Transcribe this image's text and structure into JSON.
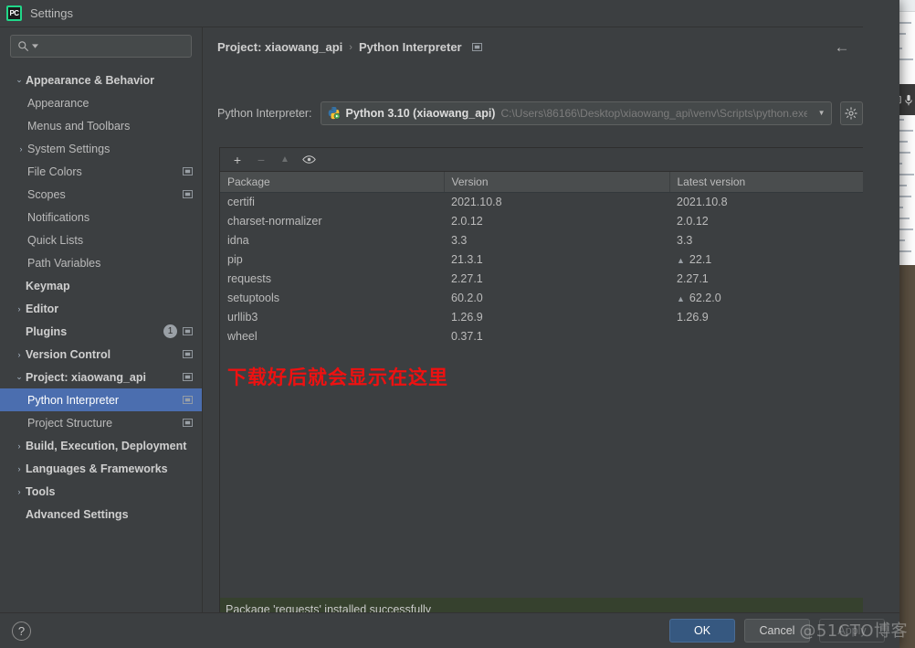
{
  "window": {
    "title": "Settings",
    "logo_text": "PC"
  },
  "search": {
    "value": "",
    "placeholder": ""
  },
  "sidebar": {
    "items": [
      {
        "label": "Appearance & Behavior",
        "arrow": "⌄",
        "indent": 0,
        "group": true,
        "selected": false,
        "copy": false,
        "badge": ""
      },
      {
        "label": "Appearance",
        "arrow": "",
        "indent": 1,
        "group": false,
        "selected": false,
        "copy": false,
        "badge": ""
      },
      {
        "label": "Menus and Toolbars",
        "arrow": "",
        "indent": 1,
        "group": false,
        "selected": false,
        "copy": false,
        "badge": ""
      },
      {
        "label": "System Settings",
        "arrow": "›",
        "indent": 1,
        "group": false,
        "selected": false,
        "copy": false,
        "badge": ""
      },
      {
        "label": "File Colors",
        "arrow": "",
        "indent": 1,
        "group": false,
        "selected": false,
        "copy": true,
        "badge": ""
      },
      {
        "label": "Scopes",
        "arrow": "",
        "indent": 1,
        "group": false,
        "selected": false,
        "copy": true,
        "badge": ""
      },
      {
        "label": "Notifications",
        "arrow": "",
        "indent": 1,
        "group": false,
        "selected": false,
        "copy": false,
        "badge": ""
      },
      {
        "label": "Quick Lists",
        "arrow": "",
        "indent": 1,
        "group": false,
        "selected": false,
        "copy": false,
        "badge": ""
      },
      {
        "label": "Path Variables",
        "arrow": "",
        "indent": 1,
        "group": false,
        "selected": false,
        "copy": false,
        "badge": ""
      },
      {
        "label": "Keymap",
        "arrow": "",
        "indent": 0,
        "group": true,
        "selected": false,
        "copy": false,
        "badge": ""
      },
      {
        "label": "Editor",
        "arrow": "›",
        "indent": 0,
        "group": true,
        "selected": false,
        "copy": false,
        "badge": ""
      },
      {
        "label": "Plugins",
        "arrow": "",
        "indent": 0,
        "group": true,
        "selected": false,
        "copy": true,
        "badge": "1"
      },
      {
        "label": "Version Control",
        "arrow": "›",
        "indent": 0,
        "group": true,
        "selected": false,
        "copy": true,
        "badge": ""
      },
      {
        "label": "Project: xiaowang_api",
        "arrow": "⌄",
        "indent": 0,
        "group": true,
        "selected": false,
        "copy": true,
        "badge": ""
      },
      {
        "label": "Python Interpreter",
        "arrow": "",
        "indent": 1,
        "group": false,
        "selected": true,
        "copy": true,
        "badge": ""
      },
      {
        "label": "Project Structure",
        "arrow": "",
        "indent": 1,
        "group": false,
        "selected": false,
        "copy": true,
        "badge": ""
      },
      {
        "label": "Build, Execution, Deployment",
        "arrow": "›",
        "indent": 0,
        "group": true,
        "selected": false,
        "copy": false,
        "badge": ""
      },
      {
        "label": "Languages & Frameworks",
        "arrow": "›",
        "indent": 0,
        "group": true,
        "selected": false,
        "copy": false,
        "badge": ""
      },
      {
        "label": "Tools",
        "arrow": "›",
        "indent": 0,
        "group": true,
        "selected": false,
        "copy": false,
        "badge": ""
      },
      {
        "label": "Advanced Settings",
        "arrow": "",
        "indent": 0,
        "group": true,
        "selected": false,
        "copy": false,
        "badge": ""
      }
    ]
  },
  "main": {
    "breadcrumb": {
      "project": "Project: xiaowang_api",
      "separator": "›",
      "page": "Python Interpreter"
    },
    "back_arrow": "←",
    "interpreter": {
      "label": "Python Interpreter:",
      "name": "Python 3.10 (xiaowang_api)",
      "path": "C:\\Users\\86166\\Desktop\\xiaowang_api\\venv\\Scripts\\python.exe",
      "dropdown_arrow": "▼"
    },
    "toolbar": {
      "add": "+",
      "remove": "−",
      "upgrade": "▲",
      "show_early": "◉"
    },
    "table": {
      "columns": [
        "Package",
        "Version",
        "Latest version"
      ],
      "rows": [
        {
          "package": "certifi",
          "version": "2021.10.8",
          "latest": "2021.10.8",
          "upgradable": false
        },
        {
          "package": "charset-normalizer",
          "version": "2.0.12",
          "latest": "2.0.12",
          "upgradable": false
        },
        {
          "package": "idna",
          "version": "3.3",
          "latest": "3.3",
          "upgradable": false
        },
        {
          "package": "pip",
          "version": "21.3.1",
          "latest": "22.1",
          "upgradable": true
        },
        {
          "package": "requests",
          "version": "2.27.1",
          "latest": "2.27.1",
          "upgradable": false
        },
        {
          "package": "setuptools",
          "version": "60.2.0",
          "latest": "62.2.0",
          "upgradable": true
        },
        {
          "package": "urllib3",
          "version": "1.26.9",
          "latest": "1.26.9",
          "upgradable": false
        },
        {
          "package": "wheel",
          "version": "0.37.1",
          "latest": "",
          "upgradable": false
        }
      ]
    },
    "annotation": "下载好后就会显示在这里",
    "status": "Package 'requests' installed successfully"
  },
  "footer": {
    "help": "?",
    "ok": "OK",
    "cancel": "Cancel",
    "apply": "Apply"
  },
  "watermark": "@51CTO博客",
  "colors": {
    "accent": "#365880",
    "selection": "#4b6eaf",
    "annotation_red": "#ee1111",
    "success_green": "#36412e",
    "panel_bg": "#3c3f41"
  }
}
